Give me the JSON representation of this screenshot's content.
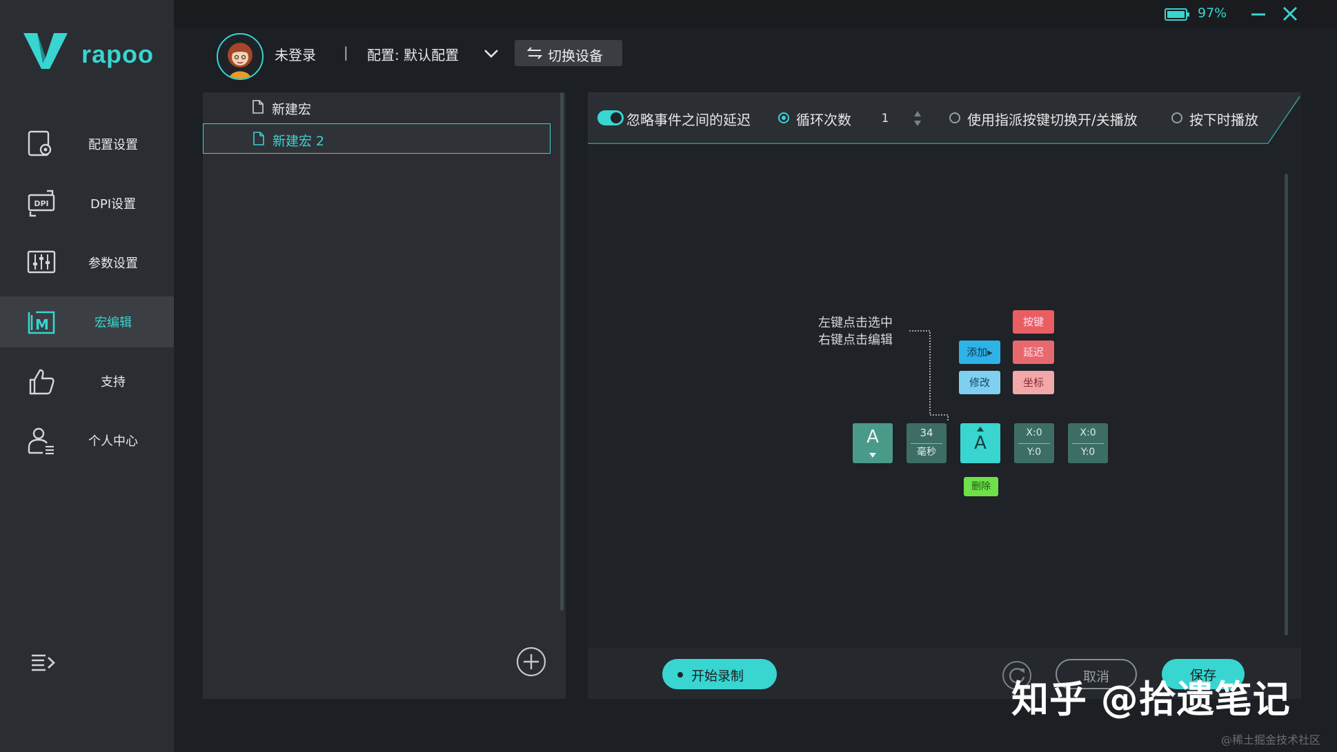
{
  "app": {
    "brand": "rapoo",
    "battery": "97%"
  },
  "sidebar": {
    "items": [
      {
        "label": "配置设置",
        "icon": "config-icon"
      },
      {
        "label": "DPI设置",
        "icon": "dpi-icon"
      },
      {
        "label": "参数设置",
        "icon": "sliders-icon"
      },
      {
        "label": "宏编辑",
        "icon": "macro-icon",
        "active": true
      },
      {
        "label": "支持",
        "icon": "thumbs-up-icon"
      },
      {
        "label": "个人中心",
        "icon": "user-icon"
      }
    ]
  },
  "header": {
    "user": "未登录",
    "separator": "|",
    "config": "配置: 默认配置",
    "switch_device": "切换设备"
  },
  "macros": {
    "items": [
      {
        "label": "新建宏",
        "selected": false
      },
      {
        "label": "新建宏 2",
        "selected": true
      }
    ]
  },
  "options": {
    "ignore_delay": "忽略事件之间的延迟",
    "loop_count": "循环次数",
    "loop_value": "1",
    "toggle_play": "使用指派按键切换开/关播放",
    "hold_play": "按下时播放"
  },
  "legend": {
    "hint_line1": "左键点击选中",
    "hint_line2": "右键点击编辑",
    "add": "添加▸",
    "modify": "修改",
    "key": "按键",
    "delay": "延迟",
    "coord": "坐标",
    "delete": "删除"
  },
  "timeline": {
    "key_down": "A",
    "delay_value": "34",
    "delay_unit": "毫秒",
    "key_up": "A",
    "pos1_x": "X:0",
    "pos1_y": "Y:0",
    "pos2_x": "X:0",
    "pos2_y": "Y:0"
  },
  "footer": {
    "record": "开始录制",
    "cancel": "取消",
    "save": "保存"
  },
  "overlay": {
    "watermark": "知乎 @拾遗笔记",
    "credit": "@稀土掘金技术社区"
  },
  "colors": {
    "accent": "#38d5d1",
    "chip_blue": "#2eb3e8",
    "chip_red": "#e85e63",
    "chip_green": "#6ee04a",
    "tile": "#4a9a8a"
  }
}
